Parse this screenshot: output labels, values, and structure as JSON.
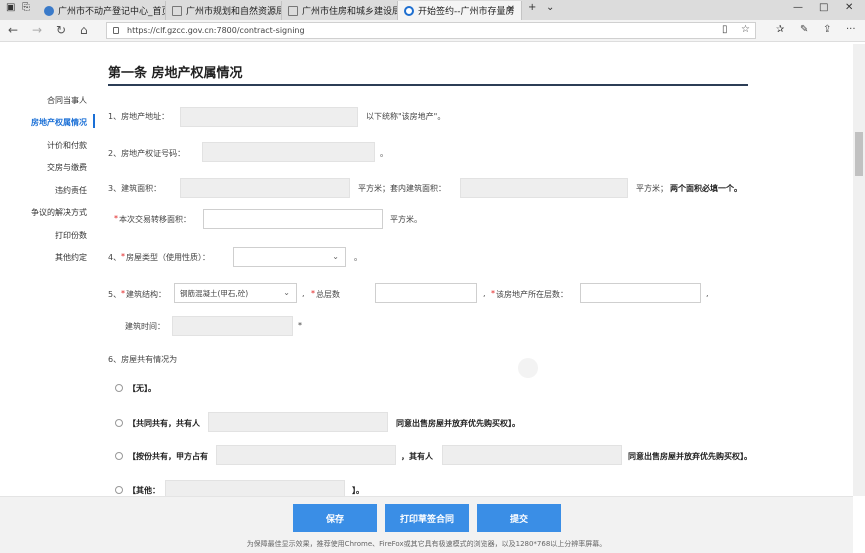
{
  "browser": {
    "tabs": [
      {
        "title": "广州市不动产登记中心_首页"
      },
      {
        "title": "广州市规划和自然资源局网"
      },
      {
        "title": "广州市住房和城乡建设局"
      },
      {
        "title": "开始签约--广州市存量房"
      }
    ],
    "url": "https://clf.gzcc.gov.cn:7800/contract-signing"
  },
  "section": {
    "title": "第一条 房地产权属情况"
  },
  "sidebar": {
    "items": [
      {
        "label": "合同当事人"
      },
      {
        "label": "房地产权属情况"
      },
      {
        "label": "计价和付款"
      },
      {
        "label": "交房与缴费"
      },
      {
        "label": "违约责任"
      },
      {
        "label": "争议的解决方式"
      },
      {
        "label": "打印份数"
      },
      {
        "label": "其他约定"
      }
    ]
  },
  "form": {
    "q1": {
      "label": "1、房地产地址：",
      "suffix": "以下统称\"该房地产\"。"
    },
    "q2": {
      "label": "2、房地产权证号码：",
      "suffix": "。"
    },
    "q3": {
      "label": "3、建筑面积：",
      "unit1": "平方米；套内建筑面积：",
      "unit2": "平方米；",
      "note": "两个面积必填一个。",
      "transfer_label": "本次交易转移面积：",
      "transfer_unit": "平方米。"
    },
    "q4": {
      "prefix": "4、",
      "label": "房屋类型（使用性质）：",
      "suffix": "。"
    },
    "q5": {
      "prefix": "5、",
      "structure_label": "建筑结构：",
      "structure_value": "钢筋混凝土(甲石,砼)",
      "floors_label": "总层数",
      "floor_at_label": "该房地产所在层数：",
      "build_time_label": "建筑时间："
    },
    "q6": {
      "label": "6、房屋共有情况为",
      "opt_none": "【无】。",
      "opt_joint": "【共同共有，共有人",
      "opt_joint_suffix": "同意出售房屋并放弃优先购买权】。",
      "opt_share": "【按份共有，甲方占有",
      "opt_share_mid": "，其有人",
      "opt_share_suffix": "同意出售房屋并放弃优先购买权】。",
      "opt_other": "【其他：",
      "opt_other_suffix": "】。"
    }
  },
  "footer": {
    "save": "保存",
    "print_draft": "打印草签合同",
    "submit": "提交",
    "note": "为保障最佳显示效果，推荐使用Chrome、FireFox或其它具有极速模式的浏览器，以及1280*768以上分辨率屏幕。"
  }
}
